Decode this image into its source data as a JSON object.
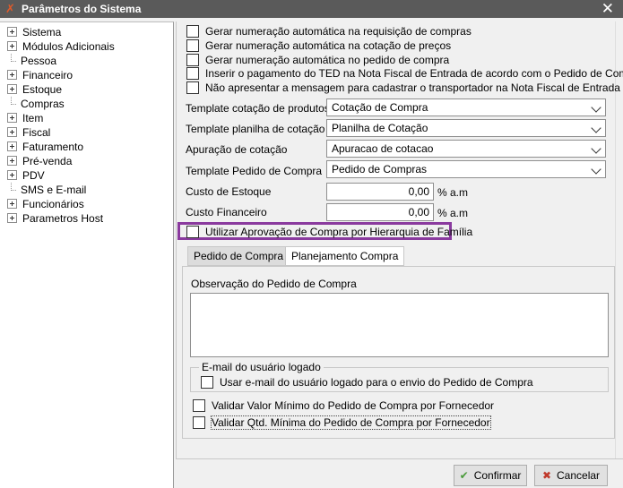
{
  "window": {
    "title": "Parâmetros do Sistema",
    "close_glyph": "✕"
  },
  "tree": {
    "items": [
      {
        "label": "Sistema",
        "expandable": true
      },
      {
        "label": "Módulos Adicionais",
        "expandable": true
      },
      {
        "label": "Pessoa",
        "expandable": false
      },
      {
        "label": "Financeiro",
        "expandable": true
      },
      {
        "label": "Estoque",
        "expandable": true
      },
      {
        "label": "Compras",
        "expandable": false
      },
      {
        "label": "Item",
        "expandable": true
      },
      {
        "label": "Fiscal",
        "expandable": true
      },
      {
        "label": "Faturamento",
        "expandable": true
      },
      {
        "label": "Pré-venda",
        "expandable": true
      },
      {
        "label": "PDV",
        "expandable": true
      },
      {
        "label": "SMS e E-mail",
        "expandable": false
      },
      {
        "label": "Funcionários",
        "expandable": true
      },
      {
        "label": "Parametros Host",
        "expandable": true
      }
    ]
  },
  "options": {
    "checkboxes": [
      "Gerar numeração automática na requisição de compras",
      "Gerar numeração automática na cotação de preços",
      "Gerar numeração automática no pedido de compra",
      "Inserir o pagamento do TED na Nota Fiscal de Entrada de acordo com o Pedido de Compra",
      "Não apresentar a mensagem para cadastrar o transportador na Nota Fiscal de Entrada"
    ]
  },
  "fields": {
    "template_cotacao": {
      "label": "Template cotação de produtos",
      "value": "Cotação  de Compra"
    },
    "template_planilha": {
      "label": "Template planilha de cotação",
      "value": "Planilha de Cotação"
    },
    "apuracao": {
      "label": "Apuração de cotação",
      "value": "Apuracao de cotacao"
    },
    "template_pedido": {
      "label": "Template Pedido de Compra",
      "value": "Pedido de Compras"
    },
    "custo_estoque": {
      "label": "Custo de Estoque",
      "value": "0,00",
      "unit": "% a.m"
    },
    "custo_financeiro": {
      "label": "Custo Financeiro",
      "value": "0,00",
      "unit": "% a.m"
    }
  },
  "hierarquia": {
    "label": "Utilizar Aprovação de Compra por Hierarquia de Família",
    "checked": false
  },
  "tabs": [
    {
      "label": "Pedido de Compra",
      "active": true
    },
    {
      "label": "Planejamento Compra",
      "active": false
    }
  ],
  "pedido": {
    "observacao_label": "Observação do Pedido de Compra",
    "observacao_value": "",
    "email_group_title": "E-mail do usuário logado",
    "email_checkbox": "Usar e-mail do usuário logado para o envio do Pedido de Compra",
    "validar_valor": "Validar Valor Mínimo do Pedido de Compra por Fornecedor",
    "validar_qtd": "Validar Qtd. Mínima do Pedido de Compra por Fornecedor"
  },
  "buttons": {
    "confirm": "Confirmar",
    "cancel": "Cancelar"
  },
  "colors": {
    "highlight": "#8a3a9e",
    "titlebar": "#5a5a5a"
  }
}
